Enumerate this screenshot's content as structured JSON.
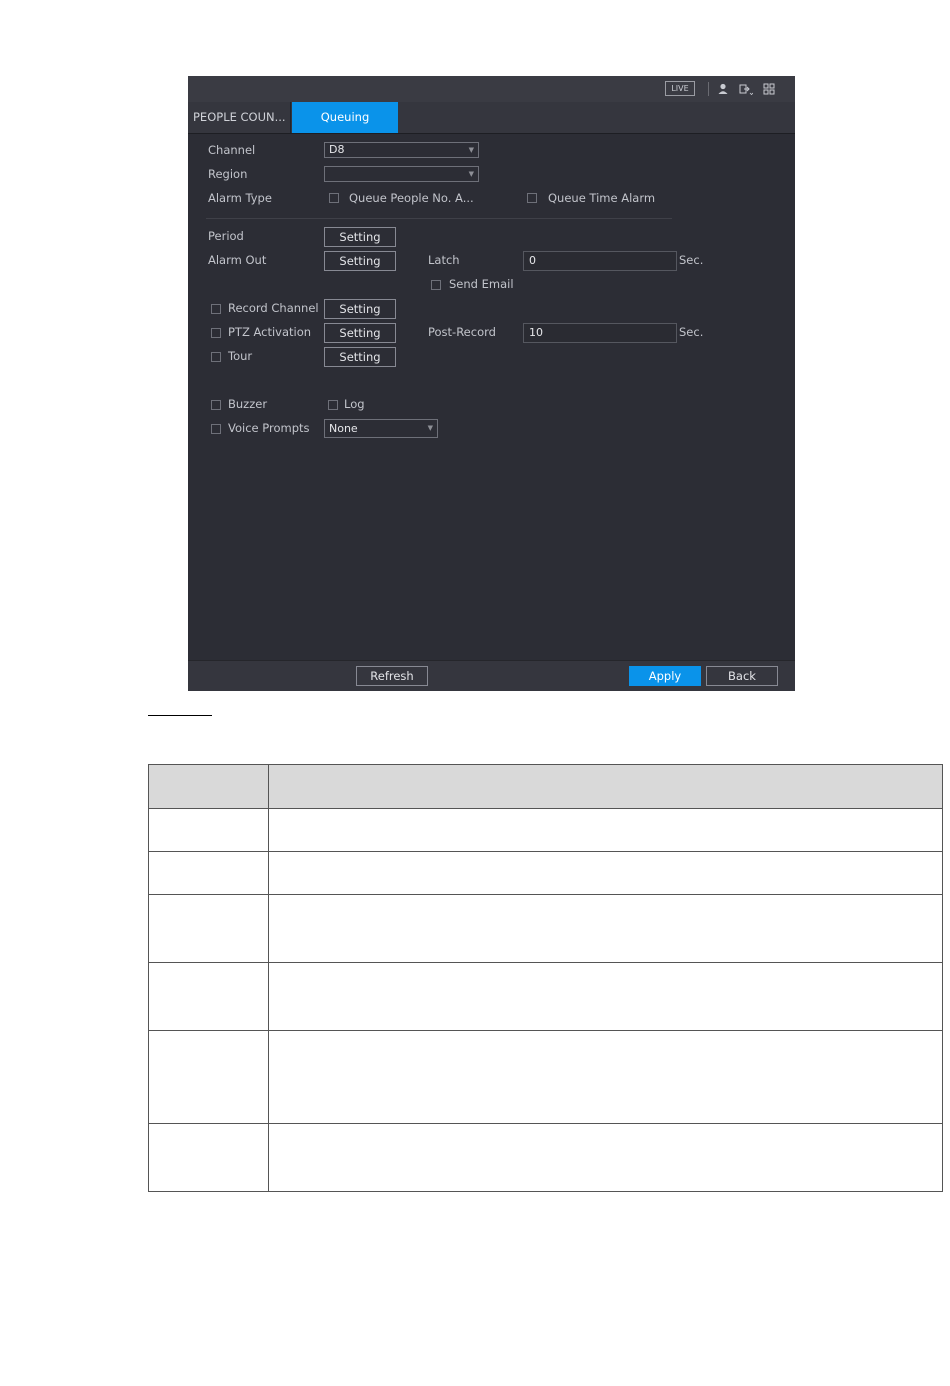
{
  "topbar": {
    "live_label": "LIVE",
    "icons": [
      "user-icon",
      "logout-icon",
      "grid-icon"
    ]
  },
  "tabs": [
    {
      "label": "PEOPLE COUN...",
      "active": false
    },
    {
      "label": "Queuing",
      "active": true
    }
  ],
  "form": {
    "channel": {
      "label": "Channel",
      "value": "D8"
    },
    "region": {
      "label": "Region",
      "value": ""
    },
    "alarm_type": {
      "label": "Alarm Type",
      "option1": "Queue People No. A...",
      "option2": "Queue Time Alarm"
    },
    "period": {
      "label": "Period",
      "button": "Setting"
    },
    "alarm_out": {
      "label": "Alarm Out",
      "button": "Setting"
    },
    "latch": {
      "label": "Latch",
      "value": "0",
      "unit": "Sec."
    },
    "send_email": {
      "label": "Send Email"
    },
    "record_channel": {
      "label": "Record Channel",
      "button": "Setting"
    },
    "ptz_activation": {
      "label": "PTZ Activation",
      "button": "Setting"
    },
    "post_record": {
      "label": "Post-Record",
      "value": "10",
      "unit": "Sec."
    },
    "tour": {
      "label": "Tour",
      "button": "Setting"
    },
    "buzzer": {
      "label": "Buzzer"
    },
    "log": {
      "label": "Log"
    },
    "voice_prompts": {
      "label": "Voice Prompts",
      "value": "None"
    }
  },
  "footer": {
    "refresh": "Refresh",
    "apply": "Apply",
    "back": "Back"
  },
  "colors": {
    "accent": "#0a93ea",
    "panel": "#2c2d35",
    "bar": "#35363e"
  }
}
